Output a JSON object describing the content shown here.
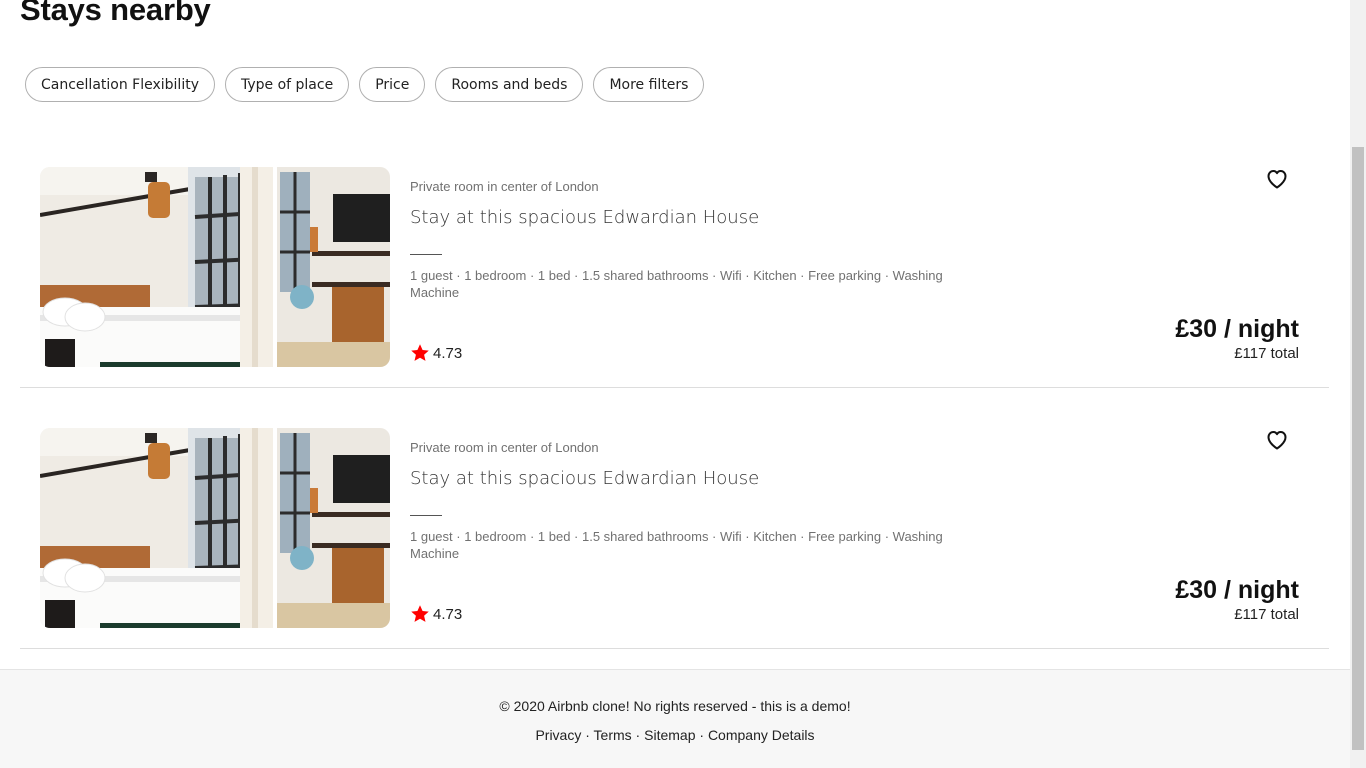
{
  "page": {
    "title": "Stays nearby"
  },
  "filters": [
    {
      "label": "Cancellation Flexibility"
    },
    {
      "label": "Type of place"
    },
    {
      "label": "Price"
    },
    {
      "label": "Rooms and beds"
    },
    {
      "label": "More filters"
    }
  ],
  "listings": [
    {
      "subtitle": "Private room in center of London",
      "name": "Stay at this spacious Edwardian House",
      "amenities": "1 guest · 1 bedroom · 1 bed · 1.5 shared bathrooms · Wifi · Kitchen · Free parking · Washing Machine",
      "rating": "4.73",
      "price": "£30 / night",
      "total": "£117 total"
    },
    {
      "subtitle": "Private room in center of London",
      "name": "Stay at this spacious Edwardian House",
      "amenities": "1 guest · 1 bedroom · 1 bed · 1.5 shared bathrooms · Wifi · Kitchen · Free parking · Washing Machine",
      "rating": "4.73",
      "price": "£30 / night",
      "total": "£117 total"
    }
  ],
  "footer": {
    "copyright": "© 2020 Airbnb clone! No rights reserved - this is a demo!",
    "links": [
      "Privacy",
      "Terms",
      "Sitemap",
      "Company Details"
    ],
    "separator": " · "
  },
  "icons": {
    "rating": "star-icon",
    "favorite": "heart-icon"
  },
  "colors": {
    "star": "#ff0000",
    "divider": "#dddddd",
    "footer_bg": "#f7f7f7"
  }
}
